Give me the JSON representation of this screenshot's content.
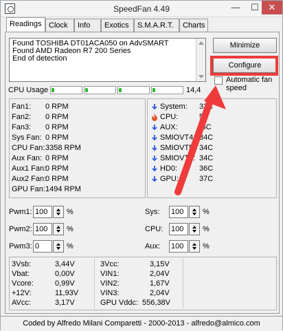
{
  "window": {
    "title": "SpeedFan 4.49",
    "controls": {
      "minimize": "—",
      "maximize": "☐",
      "close": "✕"
    }
  },
  "tabs": [
    "Readings",
    "Clock",
    "Info",
    "Exotics",
    "S.M.A.R.T.",
    "Charts"
  ],
  "log": [
    "Found TOSHIBA DT01ACA050 on AdvSMART",
    "Found AMD Radeon R7 200 Series",
    "End of detection"
  ],
  "buttons": {
    "minimize": "Minimize",
    "configure": "Configure"
  },
  "auto_fan_label": "Automatic fan speed",
  "cpu": {
    "label": "CPU Usage",
    "percent": "14,4",
    "usage": [
      0.03,
      0.03,
      0.03,
      0.03
    ]
  },
  "fans": [
    {
      "label": "Fan1:",
      "value": "0 RPM"
    },
    {
      "label": "Fan2:",
      "value": "0 RPM"
    },
    {
      "label": "Fan3:",
      "value": "0 RPM"
    },
    {
      "label": "Sys Fan:",
      "value": "0 RPM"
    },
    {
      "label": "CPU Fan:",
      "value": "3358 RPM"
    },
    {
      "label": "Aux Fan:",
      "value": "0 RPM"
    },
    {
      "label": "Aux1 Fan:",
      "value": "0 RPM"
    },
    {
      "label": "Aux2 Fan:",
      "value": "0 RPM"
    },
    {
      "label": "GPU Fan:",
      "value": "1494 RPM"
    }
  ],
  "temps": [
    {
      "label": "System:",
      "value": "33C",
      "icon": "down-arrow-icon"
    },
    {
      "label": "CPU:",
      "value": "51",
      "icon": "flame-icon"
    },
    {
      "label": "AUX:",
      "value": "-6C",
      "icon": "down-arrow-icon"
    },
    {
      "label": "SMIOVT4:",
      "value": "34C",
      "icon": "down-arrow-icon"
    },
    {
      "label": "SMIOVT5:",
      "value": "34C",
      "icon": "down-arrow-icon"
    },
    {
      "label": "SMIOVT6:",
      "value": "34C",
      "icon": "down-arrow-icon"
    },
    {
      "label": "HD0:",
      "value": "36C",
      "icon": "down-arrow-icon"
    },
    {
      "label": "GPU:",
      "value": "37C",
      "icon": "down-arrow-icon"
    }
  ],
  "pwm": [
    {
      "label": "Pwm1:",
      "value": "100"
    },
    {
      "label": "Pwm2:",
      "value": "100"
    },
    {
      "label": "Pwm3:",
      "value": "0"
    }
  ],
  "controls": [
    {
      "label": "Sys:",
      "value": "100"
    },
    {
      "label": "CPU:",
      "value": "100"
    },
    {
      "label": "Aux:",
      "value": "100"
    }
  ],
  "percent_sign": "%",
  "voltages_left": [
    {
      "label": "3Vsb:",
      "value": "3,44V"
    },
    {
      "label": "Vbat:",
      "value": "0,00V"
    },
    {
      "label": "Vcore:",
      "value": "0,99V"
    },
    {
      "label": "+12V:",
      "value": "11,93V"
    },
    {
      "label": "AVcc:",
      "value": "3,17V"
    }
  ],
  "voltages_right": [
    {
      "label": "3Vcc:",
      "value": "3,15V"
    },
    {
      "label": "VIN1:",
      "value": "2,04V"
    },
    {
      "label": "VIN2:",
      "value": "1,67V"
    },
    {
      "label": "VIN3:",
      "value": "2,04V"
    },
    {
      "label": "GPU Vddc:",
      "value": "556,38V"
    }
  ],
  "footer": "Coded by Alfredo Milani Comparetti - 2000-2013 - alfredo@almico.com",
  "colors": {
    "accent": "#ef3b3b",
    "bar": "#2fb92f",
    "temp_icon": "#2b5ae0"
  }
}
